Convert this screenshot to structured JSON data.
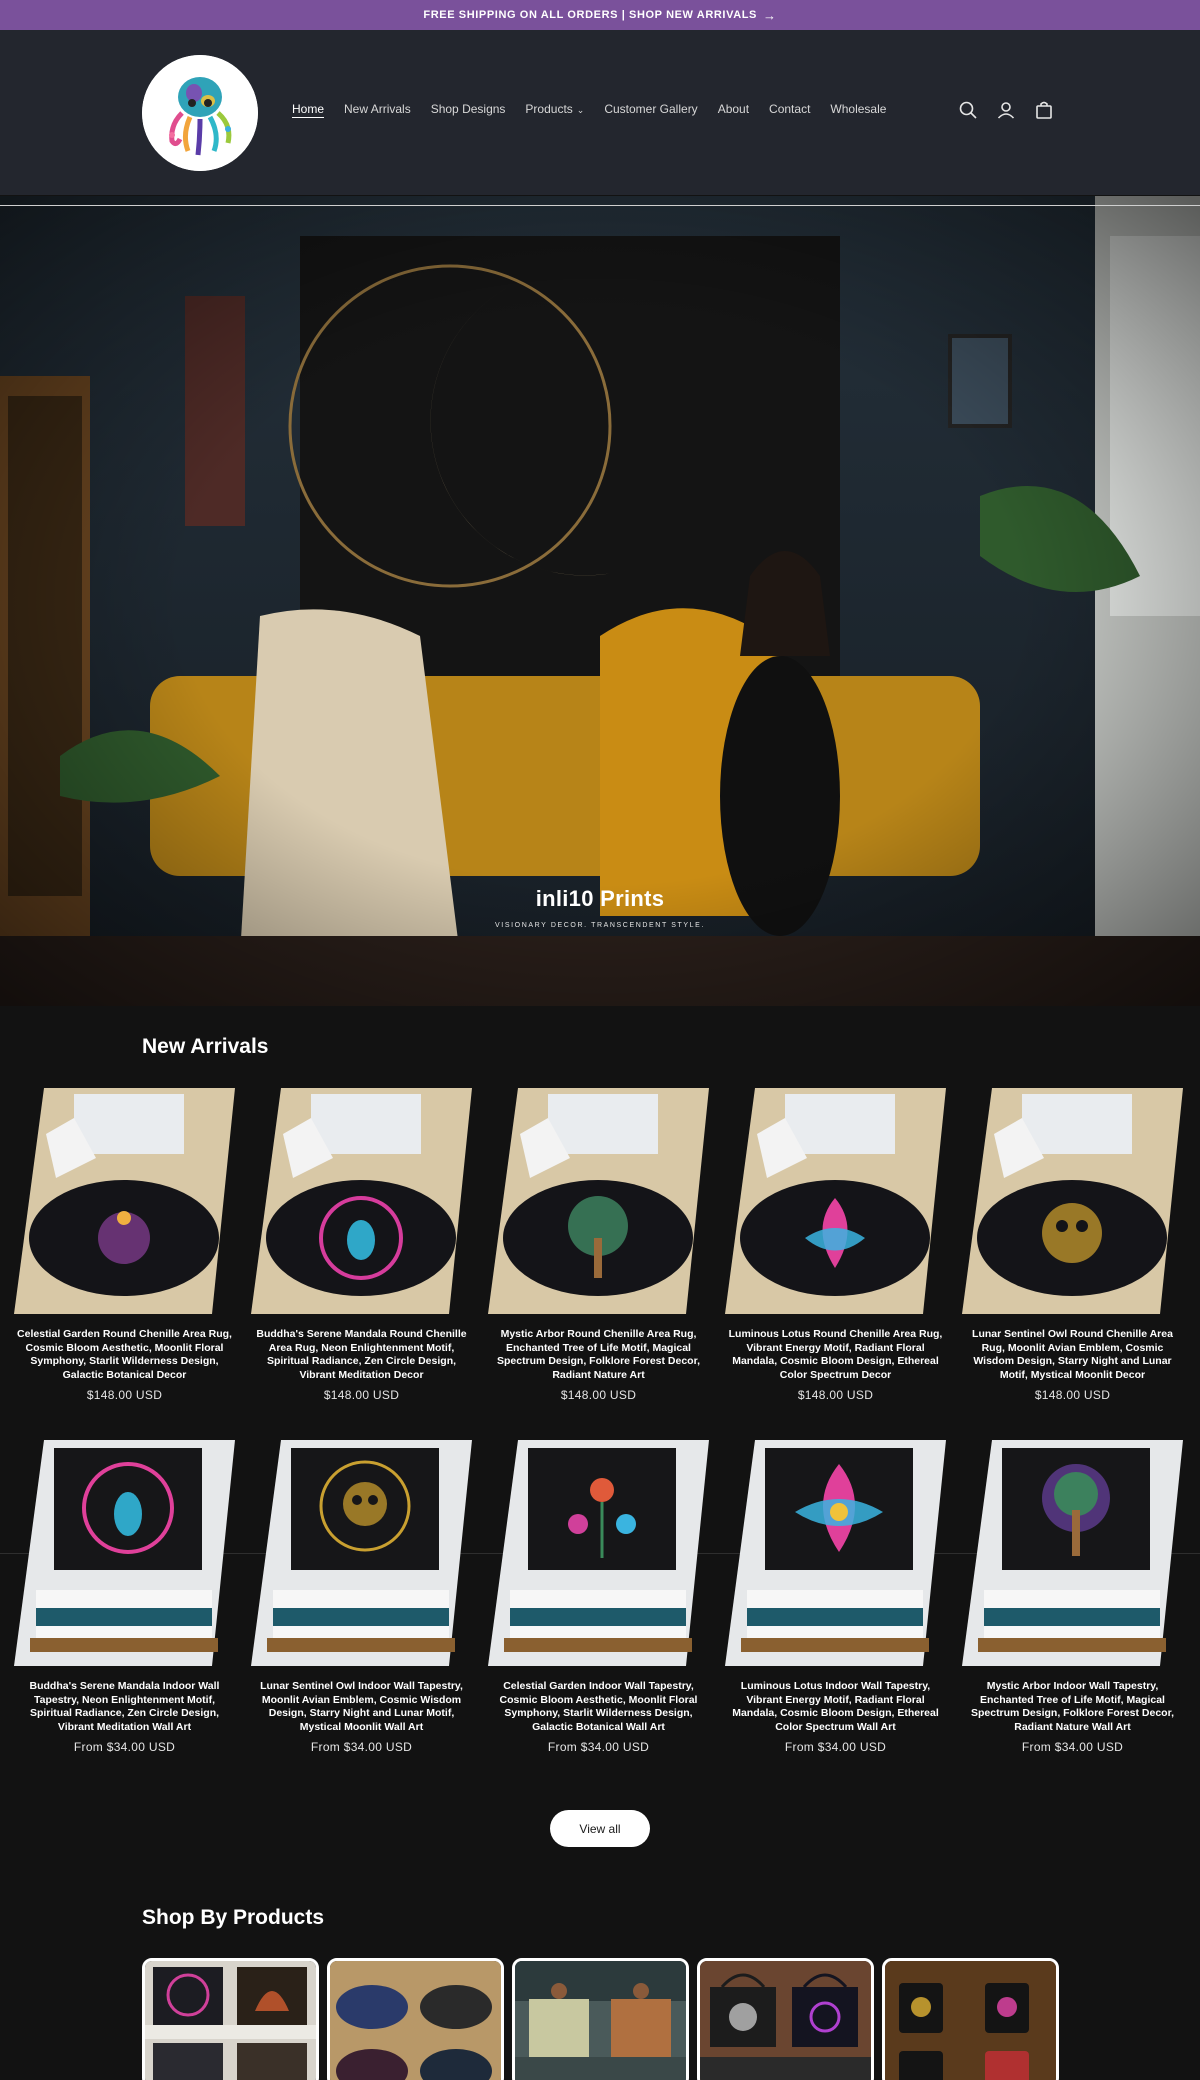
{
  "announcement": {
    "text": "FREE SHIPPING ON ALL ORDERS | SHOP NEW ARRIVALS",
    "arrow_icon": "arrow-right-icon"
  },
  "header": {
    "logo_alt": "inli10 Prints octopus logo",
    "nav": [
      {
        "label": "Home",
        "active": true
      },
      {
        "label": "New Arrivals"
      },
      {
        "label": "Shop Designs"
      },
      {
        "label": "Products",
        "has_dropdown": true
      },
      {
        "label": "Customer Gallery"
      },
      {
        "label": "About"
      },
      {
        "label": "Contact"
      },
      {
        "label": "Wholesale"
      }
    ],
    "icons": [
      "search-icon",
      "account-icon",
      "cart-icon"
    ]
  },
  "hero": {
    "title": "inli10 Prints",
    "subtitle": "VISIONARY DECOR. TRANSCENDENT STYLE."
  },
  "new_arrivals": {
    "title": "New Arrivals",
    "rugs": [
      {
        "name": "Celestial Garden Round Chenille Area Rug, Cosmic Bloom Aesthetic, Moonlit Floral Symphony, Starlit Wilderness Design, Galactic Botanical Decor",
        "price": "$148.00 USD"
      },
      {
        "name": "Buddha's Serene Mandala Round Chenille Area Rug, Neon Enlightenment Motif, Spiritual Radiance, Zen Circle Design, Vibrant Meditation Decor",
        "price": "$148.00 USD"
      },
      {
        "name": "Mystic Arbor Round Chenille Area Rug, Enchanted Tree of Life Motif, Magical Spectrum Design, Folklore Forest Decor, Radiant Nature Art",
        "price": "$148.00 USD"
      },
      {
        "name": "Luminous Lotus Round Chenille Area Rug, Vibrant Energy Motif, Radiant Floral Mandala, Cosmic Bloom Design, Ethereal Color Spectrum Decor",
        "price": "$148.00 USD"
      },
      {
        "name": "Lunar Sentinel Owl Round Chenille Area Rug, Moonlit Avian Emblem, Cosmic Wisdom Design, Starry Night and Lunar Motif, Mystical Moonlit Decor",
        "price": "$148.00 USD"
      }
    ],
    "tapestries": [
      {
        "name": "Buddha's Serene Mandala Indoor Wall Tapestry, Neon Enlightenment Motif, Spiritual Radiance, Zen Circle Design, Vibrant Meditation Wall Art",
        "price": "From $34.00 USD"
      },
      {
        "name": "Lunar Sentinel Owl Indoor Wall Tapestry, Moonlit Avian Emblem, Cosmic Wisdom Design, Starry Night and Lunar Motif, Mystical Moonlit Wall Art",
        "price": "From $34.00 USD"
      },
      {
        "name": "Celestial Garden Indoor Wall Tapestry, Cosmic Bloom Aesthetic, Moonlit Floral Symphony, Starlit Wilderness Design, Galactic Botanical Wall Art",
        "price": "From $34.00 USD"
      },
      {
        "name": "Luminous Lotus Indoor Wall Tapestry, Vibrant Energy Motif, Radiant Floral Mandala, Cosmic Bloom Design, Ethereal Color Spectrum Wall Art",
        "price": "From $34.00 USD"
      },
      {
        "name": "Mystic Arbor Indoor Wall Tapestry, Enchanted Tree of Life Motif, Magical Spectrum Design, Folklore Forest Decor, Radiant Nature Wall Art",
        "price": "From $34.00 USD"
      }
    ],
    "view_all": "View all"
  },
  "shop_by_products": {
    "title": "Shop By Products",
    "categories": [
      "tapestries",
      "rugs",
      "blankets",
      "tote bags",
      "mugs"
    ]
  },
  "colors": {
    "announcement_bg": "#7a519b",
    "header_bg": "#23262e",
    "page_bg": "#121212",
    "button_bg": "#ffffff"
  }
}
